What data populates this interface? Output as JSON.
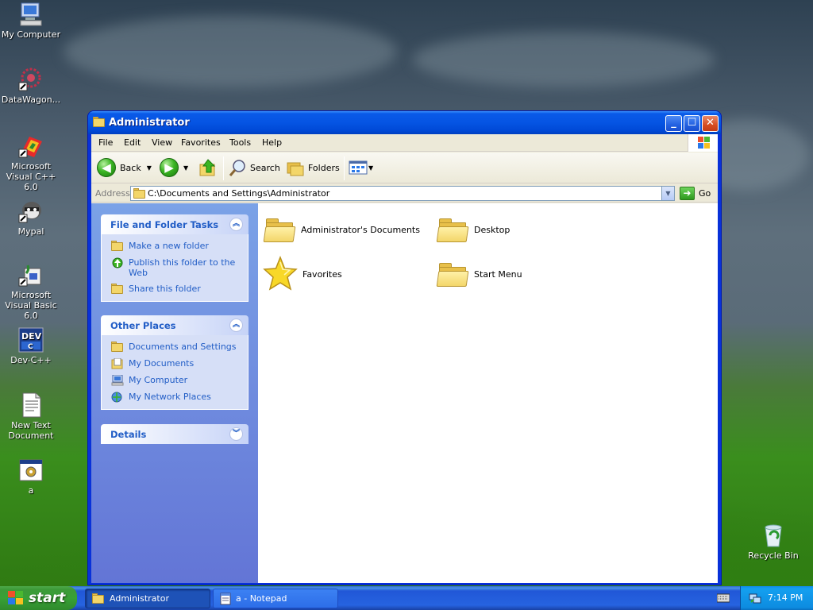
{
  "desktop": {
    "icons": [
      {
        "label": "My Computer",
        "icon": "my-computer-icon"
      },
      {
        "label": "DataWagon...",
        "icon": "datawagon-icon"
      },
      {
        "label": "Microsoft Visual C++ 6.0",
        "icon": "visual-cpp-icon"
      },
      {
        "label": "Mypal",
        "icon": "mypal-icon"
      },
      {
        "label": "Microsoft Visual Basic 6.0",
        "icon": "visual-basic-icon"
      },
      {
        "label": "Dev-C++",
        "icon": "dev-cpp-icon"
      },
      {
        "label": "New Text Document",
        "icon": "text-document-icon"
      },
      {
        "label": "a",
        "icon": "executable-icon"
      },
      {
        "label": "Recycle Bin",
        "icon": "recycle-bin-icon"
      }
    ]
  },
  "window": {
    "title": "Administrator",
    "menu": [
      "File",
      "Edit",
      "View",
      "Favorites",
      "Tools",
      "Help"
    ],
    "toolbar": {
      "back_label": "Back",
      "search_label": "Search",
      "folders_label": "Folders"
    },
    "address": {
      "label": "Address",
      "value": "C:\\Documents and Settings\\Administrator",
      "go_label": "Go"
    },
    "taskpane": {
      "file_tasks": {
        "title": "File and Folder Tasks",
        "links": [
          "Make a new folder",
          "Publish this folder to the Web",
          "Share this folder"
        ]
      },
      "other_places": {
        "title": "Other Places",
        "links": [
          "Documents and Settings",
          "My Documents",
          "My Computer",
          "My Network Places"
        ]
      },
      "details": {
        "title": "Details"
      }
    },
    "items": [
      {
        "label": "Administrator's Documents",
        "icon": "folder-icon"
      },
      {
        "label": "Desktop",
        "icon": "folder-icon"
      },
      {
        "label": "Favorites",
        "icon": "star-icon"
      },
      {
        "label": "Start Menu",
        "icon": "folder-icon"
      }
    ]
  },
  "taskbar": {
    "start_label": "start",
    "tasks": [
      {
        "label": "Administrator",
        "active": true
      },
      {
        "label": "a - Notepad",
        "active": false
      }
    ],
    "clock": "7:14 PM"
  },
  "colors": {
    "title_blue": "#0554e3",
    "link_blue": "#215dc6",
    "start_green": "#38a136"
  }
}
